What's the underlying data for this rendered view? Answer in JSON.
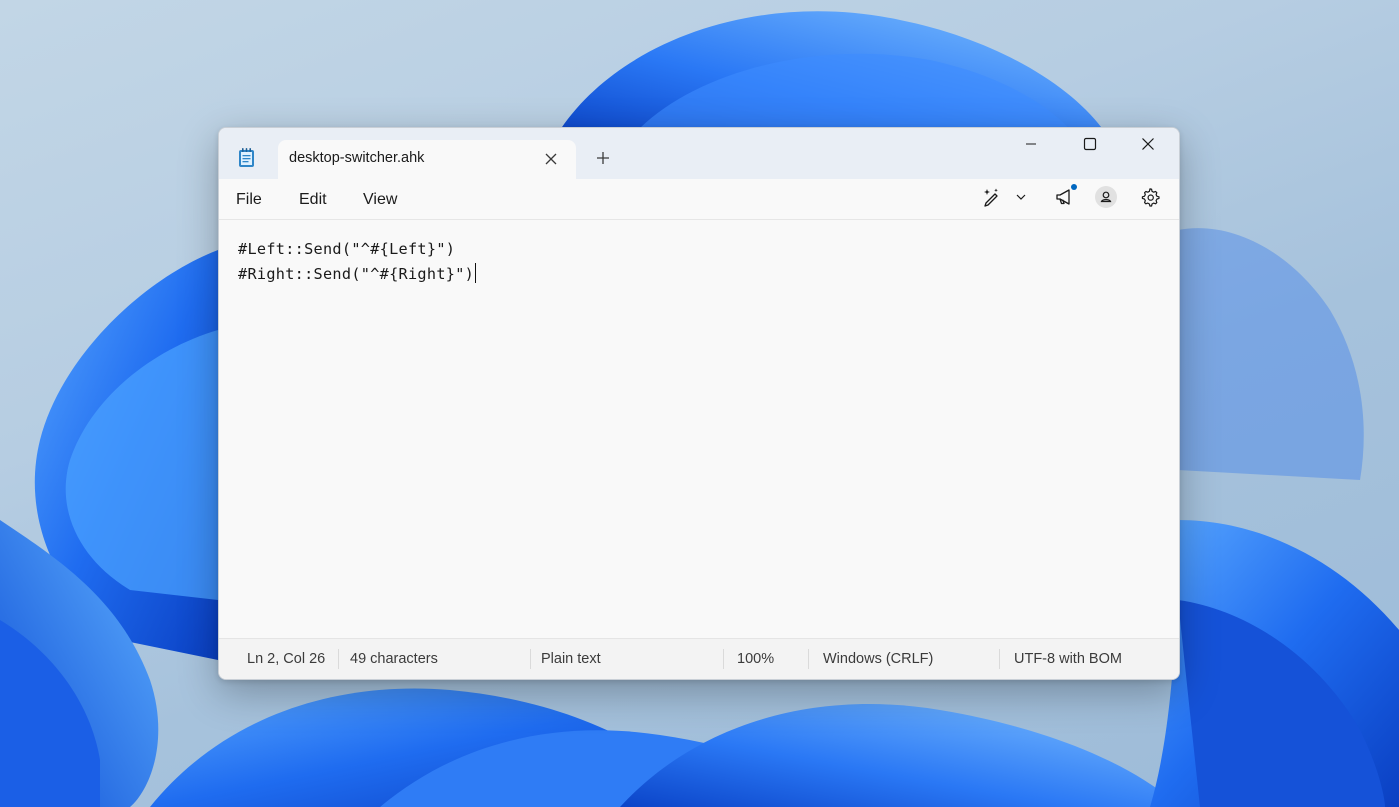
{
  "window": {
    "tab_title": "desktop-switcher.ahk"
  },
  "menu": {
    "file": "File",
    "edit": "Edit",
    "view": "View"
  },
  "editor": {
    "lines": [
      "#Left::Send(\"^#{Left}\")",
      "#Right::Send(\"^#{Right}\")"
    ]
  },
  "status": {
    "position": "Ln 2, Col 26",
    "characters": "49 characters",
    "format": "Plain text",
    "zoom": "100%",
    "line_ending": "Windows (CRLF)",
    "encoding": "UTF-8 with BOM"
  },
  "icons": {
    "app": "notepad-icon",
    "tab_close": "close-icon",
    "new_tab": "plus-icon",
    "minimize": "minimize-icon",
    "maximize": "maximize-icon",
    "close": "close-icon",
    "copilot": "sparkle-pen-icon",
    "dropdown": "chevron-down-icon",
    "whats_new": "megaphone-icon",
    "account": "account-icon",
    "settings": "gear-icon"
  },
  "colors": {
    "accent": "#0067c0",
    "titlebar": "#e9eef5",
    "editor_bg": "#f9f9f9",
    "wallpaper_blue": "#1a5fe0"
  }
}
